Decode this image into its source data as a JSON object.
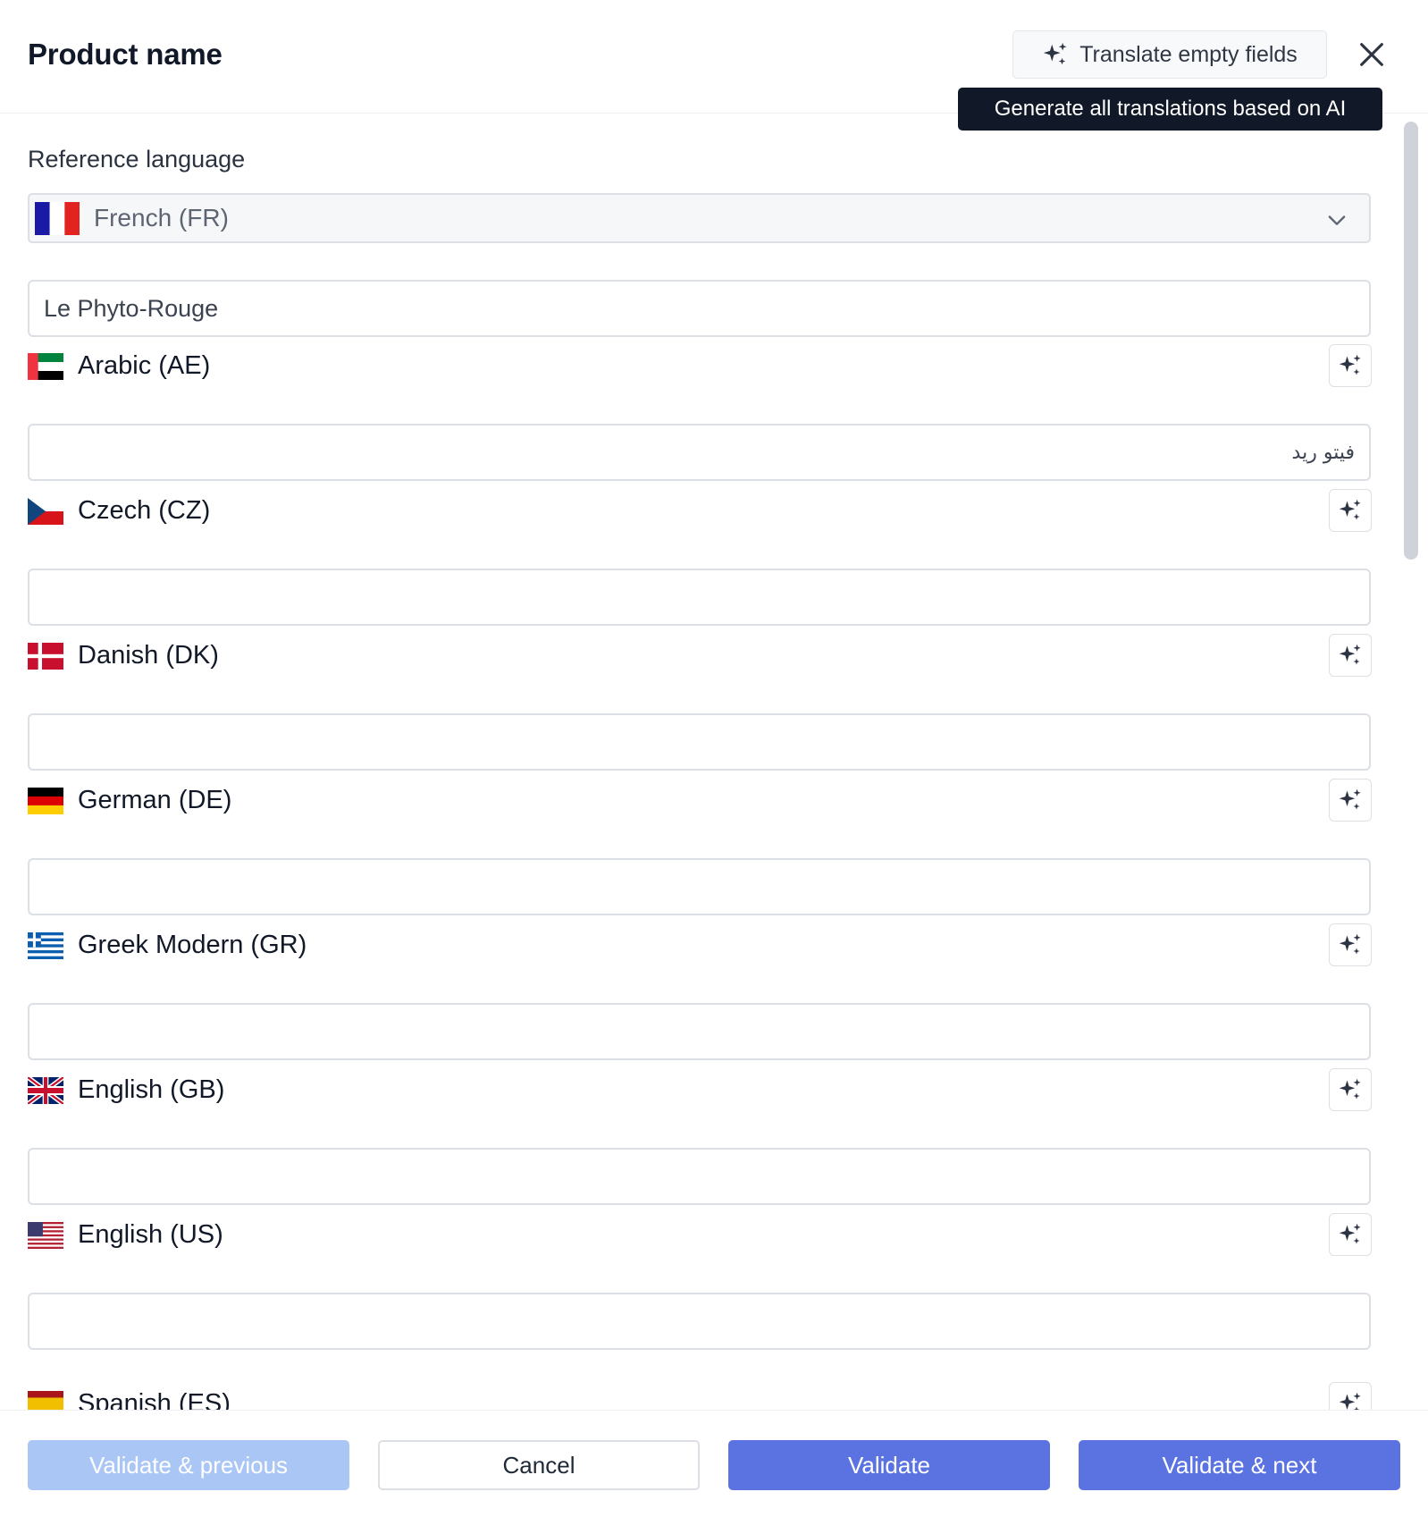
{
  "header": {
    "title": "Product name",
    "translate_button_label": "Translate empty fields",
    "tooltip": "Generate all translations based on AI",
    "close_icon": "close-icon"
  },
  "reference": {
    "label": "Reference language",
    "selected": "French (FR)",
    "flag": "fr-flag-icon",
    "value": "Le Phyto-Rouge"
  },
  "languages": [
    {
      "label": "Arabic (AE)",
      "flag": "ae-flag-icon",
      "value": "فيتو ريد"
    },
    {
      "label": "Czech (CZ)",
      "flag": "cz-flag-icon",
      "value": ""
    },
    {
      "label": "Danish (DK)",
      "flag": "dk-flag-icon",
      "value": ""
    },
    {
      "label": "German (DE)",
      "flag": "de-flag-icon",
      "value": ""
    },
    {
      "label": "Greek Modern (GR)",
      "flag": "gr-flag-icon",
      "value": ""
    },
    {
      "label": "English (GB)",
      "flag": "gb-flag-icon",
      "value": ""
    },
    {
      "label": "English (US)",
      "flag": "us-flag-icon",
      "value": ""
    },
    {
      "label": "Spanish (ES)",
      "flag": "es-flag-icon",
      "value": ""
    }
  ],
  "footer": {
    "prev_label": "Validate & previous",
    "cancel_label": "Cancel",
    "validate_label": "Validate",
    "next_label": "Validate & next"
  },
  "colors": {
    "primary": "#5b73e1",
    "primary_disabled": "#aac6f5",
    "tooltip_bg": "#111827",
    "border": "#dcdfe4"
  }
}
